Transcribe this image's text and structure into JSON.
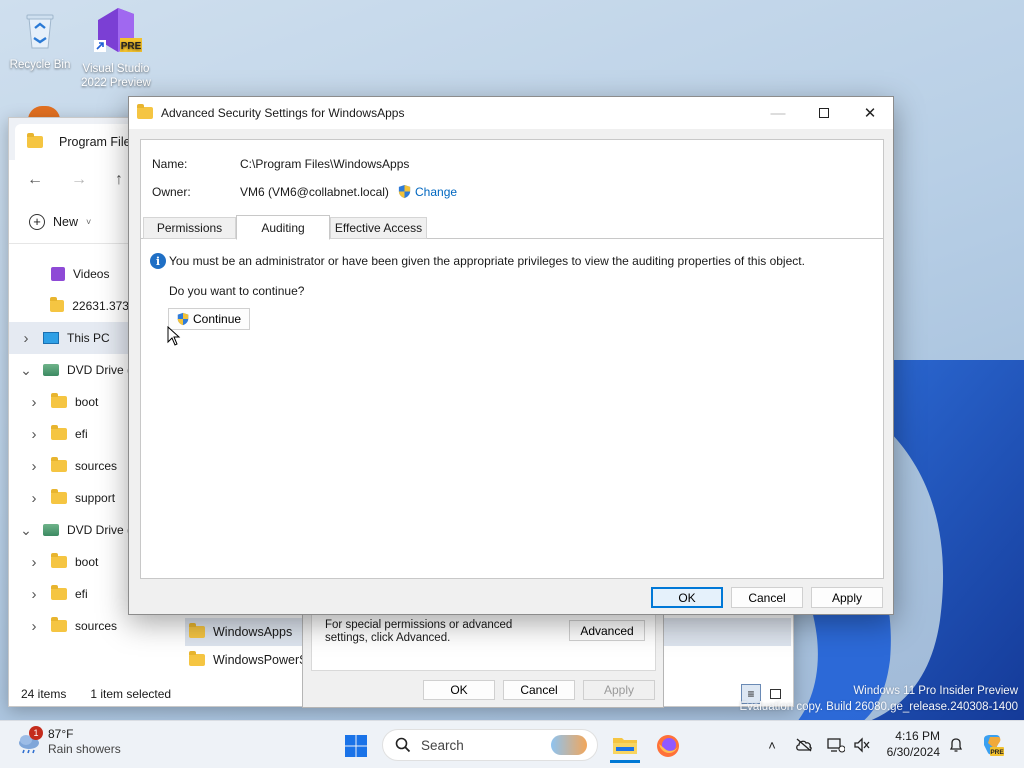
{
  "desktop": {
    "icons": [
      {
        "label": "Recycle Bin"
      },
      {
        "label": "Visual Studio 2022 Preview",
        "badge": "PRE"
      }
    ],
    "watermark_line1": "Windows 11 Pro Insider Preview",
    "watermark_line2": "Evaluation copy. Build 26080.ge_release.240308-1400"
  },
  "explorer": {
    "tab_title": "Program Files",
    "new_label": "New",
    "tree": [
      {
        "label": "Videos",
        "indent": 1,
        "icon": "videos-icon"
      },
      {
        "label": "22631.3737_a",
        "indent": 1,
        "icon": "folder-icon"
      },
      {
        "label": "This PC",
        "indent": 0,
        "icon": "pc-icon",
        "selected": true,
        "chevron": "right"
      },
      {
        "label": "DVD Drive (E",
        "indent": 0,
        "icon": "dvd-icon",
        "chevron": "down"
      },
      {
        "label": "boot",
        "indent": 1,
        "icon": "folder-icon",
        "chevron": "right"
      },
      {
        "label": "efi",
        "indent": 1,
        "icon": "folder-icon",
        "chevron": "right"
      },
      {
        "label": "sources",
        "indent": 1,
        "icon": "folder-icon",
        "chevron": "right"
      },
      {
        "label": "support",
        "indent": 1,
        "icon": "folder-icon",
        "chevron": "right"
      },
      {
        "label": "DVD Drive (F",
        "indent": 0,
        "icon": "dvd-icon",
        "chevron": "down"
      },
      {
        "label": "boot",
        "indent": 1,
        "icon": "folder-icon",
        "chevron": "right"
      },
      {
        "label": "efi",
        "indent": 1,
        "icon": "folder-icon",
        "chevron": "right"
      },
      {
        "label": "sources",
        "indent": 1,
        "icon": "folder-icon",
        "chevron": "right"
      }
    ],
    "files": [
      {
        "label": "WindowsApps",
        "selected": true
      },
      {
        "label": "WindowsPowerShe"
      }
    ],
    "status_count": "24 items",
    "status_selected": "1 item selected"
  },
  "properties_dialog": {
    "advanced_text": "For special permissions or advanced settings, click Advanced.",
    "advanced_button": "Advanced",
    "ok": "OK",
    "cancel": "Cancel",
    "apply": "Apply"
  },
  "dialog": {
    "title": "Advanced Security Settings for WindowsApps",
    "name_label": "Name:",
    "name_value": "C:\\Program Files\\WindowsApps",
    "owner_label": "Owner:",
    "owner_value": "VM6 (VM6@collabnet.local)",
    "change_link": "Change",
    "tabs": [
      "Permissions",
      "Auditing",
      "Effective Access"
    ],
    "active_tab": "Auditing",
    "info_message": "You must be an administrator or have been given the appropriate privileges to view the auditing properties of this object.",
    "question": "Do you want to continue?",
    "continue_button": "Continue",
    "ok": "OK",
    "cancel": "Cancel",
    "apply": "Apply"
  },
  "taskbar": {
    "weather_temp": "87°F",
    "weather_desc": "Rain showers",
    "weather_badge": "1",
    "search_placeholder": "Search",
    "time": "4:16 PM",
    "date": "6/30/2024"
  },
  "colors": {
    "accent": "#0078d7",
    "link": "#0067c0",
    "folder": "#f5c542"
  }
}
